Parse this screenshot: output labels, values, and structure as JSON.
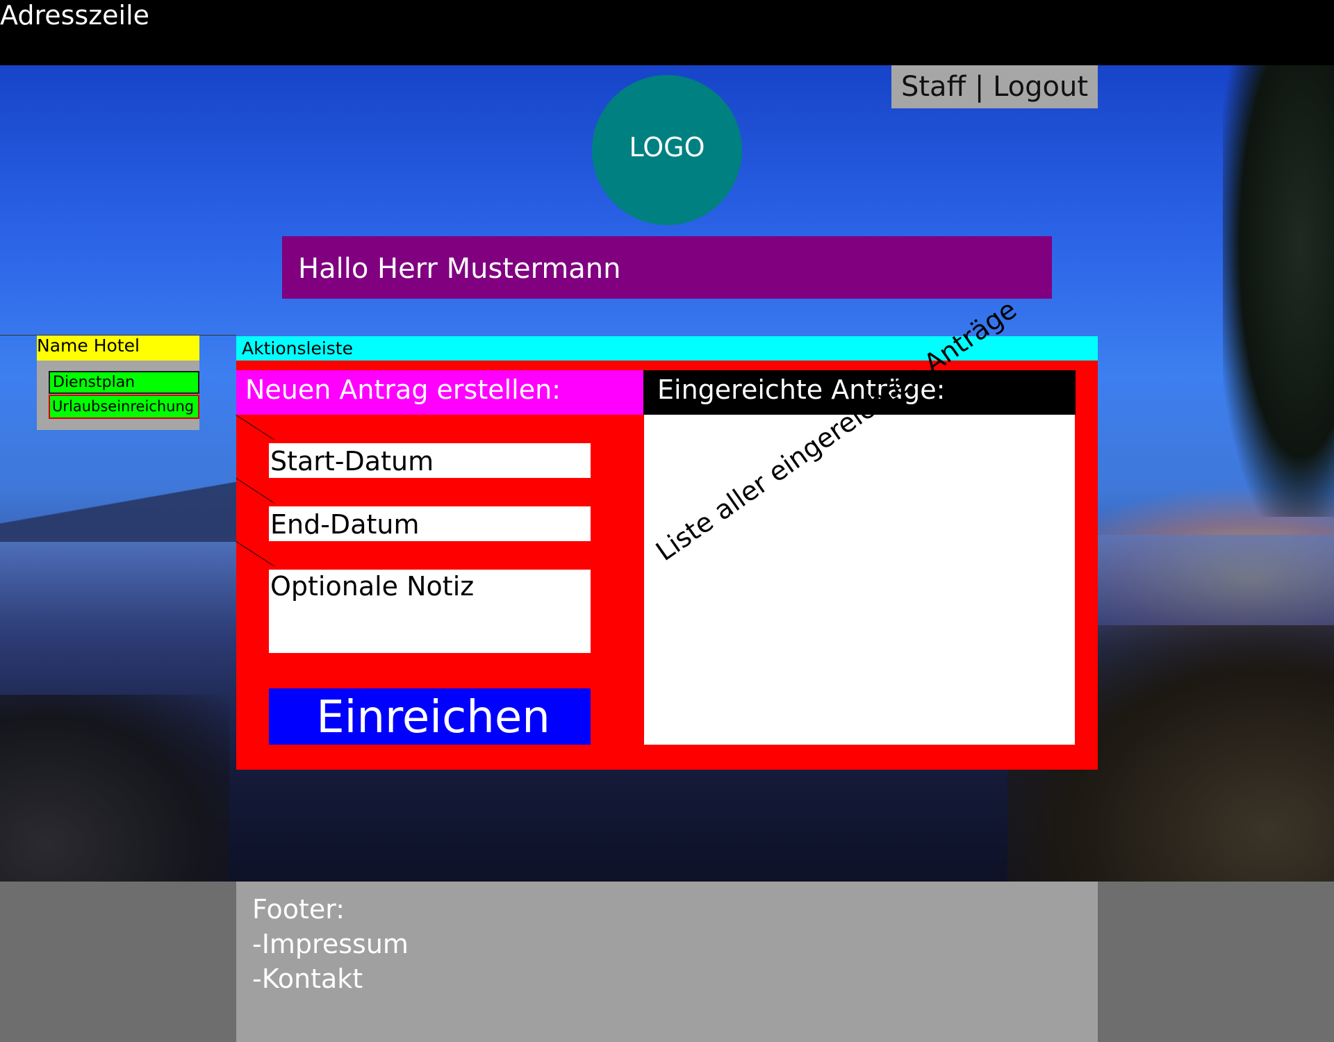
{
  "address_bar": {
    "label": "Adresszeile"
  },
  "header": {
    "staff_label": "Staff",
    "separator": "|",
    "logout_label": "Logout",
    "logo_text": "LOGO",
    "greeting": "Hallo Herr Mustermann"
  },
  "sidebar": {
    "hotel_name": "Name Hotel",
    "items": [
      {
        "label": "Dienstplan"
      },
      {
        "label": "Urlaubseinreichung"
      }
    ]
  },
  "action_bar": {
    "label": "Aktionsleiste"
  },
  "new_request": {
    "title": "Neuen Antrag erstellen:",
    "start_date_placeholder": "Start-Datum",
    "end_date_placeholder": "End-Datum",
    "note_placeholder": "Optionale Notiz",
    "submit_label": "Einreichen"
  },
  "submitted_requests": {
    "title": "Eingereichte Anträge:",
    "list_placeholder": "Liste aller eingereichten Anträge"
  },
  "footer": {
    "title": "Footer:",
    "links": [
      "-Impressum",
      "-Kontakt"
    ]
  },
  "colors": {
    "address_bar": "#000000",
    "logo": "#008080",
    "greeting": "#800080",
    "hotel_name": "#ffff00",
    "nav_item": "#00ff00",
    "action_bar": "#00ffff",
    "main_panel": "#ff0000",
    "new_request_title": "#ff00ff",
    "submit_button": "#0000ff",
    "footer": "#a0a0a0"
  }
}
